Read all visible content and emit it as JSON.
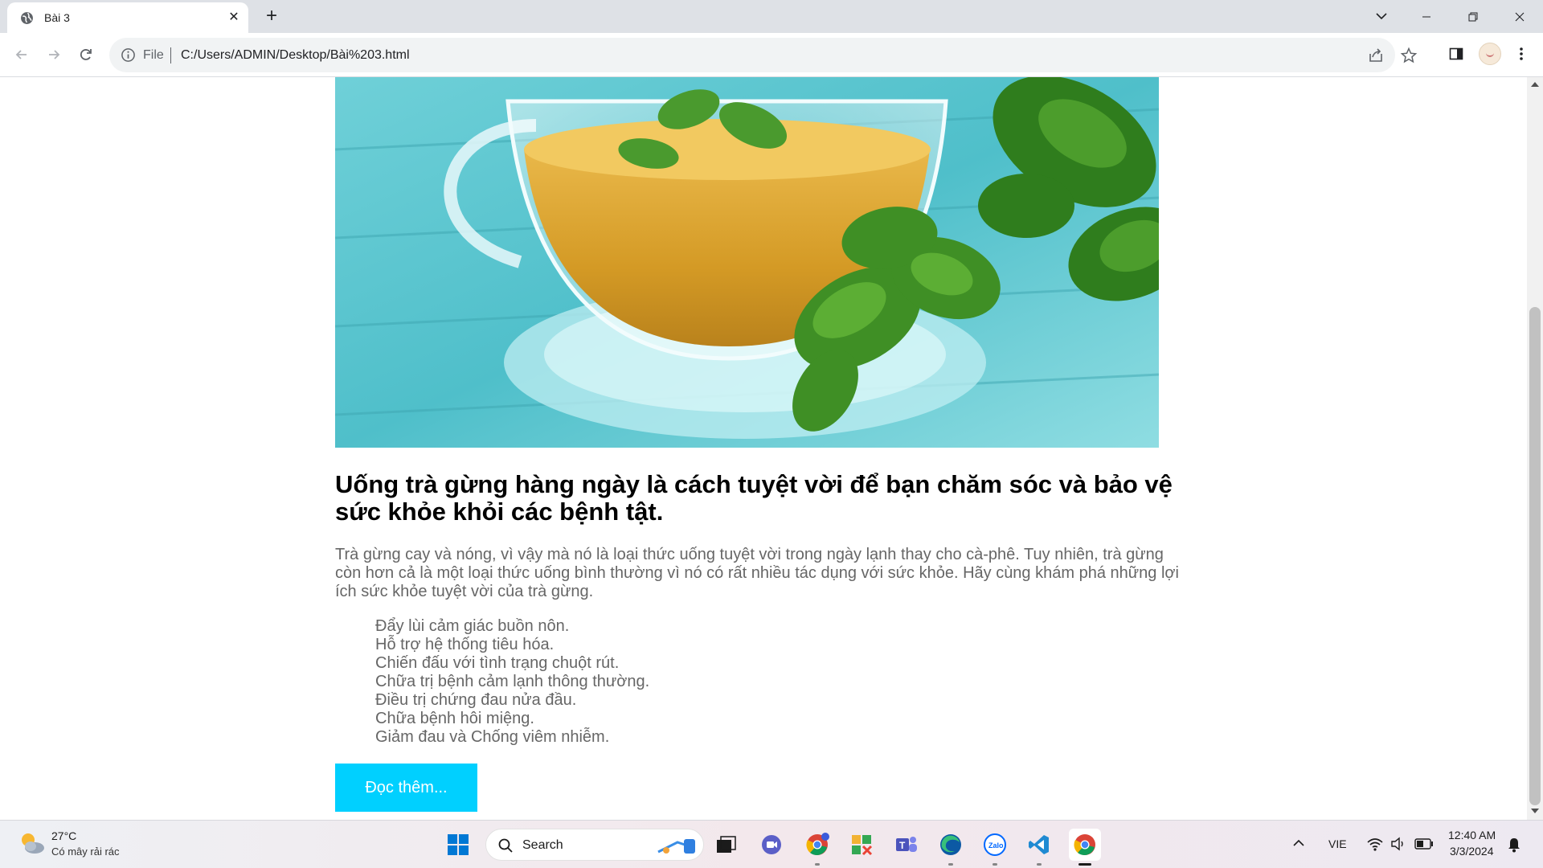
{
  "browser": {
    "tab_title": "Bài 3",
    "tab_close": "✕",
    "new_tab": "+",
    "scheme": "File",
    "url": "C:/Users/ADMIN/Desktop/Bài%203.html"
  },
  "article": {
    "hero_alt": "Tea cup with mint leaves",
    "title": "Uống trà gừng hàng ngày là cách tuyệt vời để bạn chăm sóc và bảo vệ sức khỏe khỏi các bệnh tật.",
    "intro": "Trà gừng cay và nóng, vì vậy mà nó là loại thức uống tuyệt vời trong ngày lạnh thay cho cà-phê. Tuy nhiên, trà gừng còn hơn cả là một loại thức uống bình thường vì nó có rất nhiều tác dụng với sức khỏe. Hãy cùng khám phá những lợi ích sức khỏe tuyệt vời của trà gừng.",
    "benefits": [
      "Đẩy lùi cảm giác buồn nôn.",
      "Hỗ trợ hệ thống tiêu hóa.",
      "Chiến đấu với tình trạng chuột rút.",
      "Chữa trị bệnh cảm lạnh thông thường.",
      "Điều trị chứng đau nửa đầu.",
      "Chữa bệnh hôi miệng.",
      "Giảm đau và Chống viêm nhiễm."
    ],
    "read_more": "Đọc thêm..."
  },
  "taskbar": {
    "temperature": "27°C",
    "condition": "Có mây rải rác",
    "search": "Search",
    "language": "VIE",
    "time": "12:40 AM",
    "date": "3/3/2024"
  },
  "colors": {
    "button_bg": "#00d0ff",
    "text_gray": "#666666"
  }
}
